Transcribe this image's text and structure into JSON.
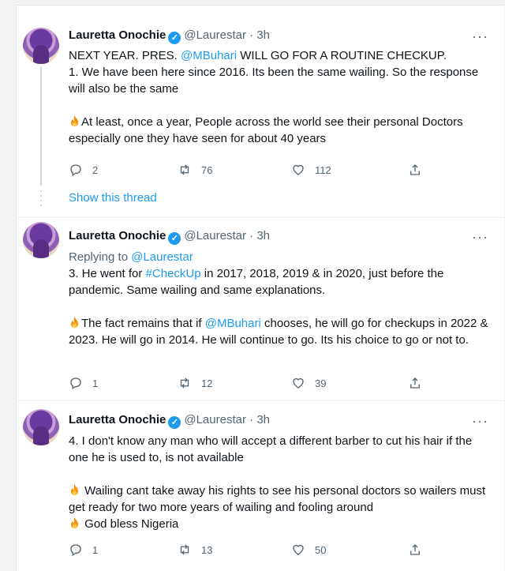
{
  "tweets": [
    {
      "name": "Lauretta Onochie",
      "handle": "@Laurestar",
      "sep": "·",
      "time": "3h",
      "line1_a": "NEXT YEAR. PRES. ",
      "line1_mention": "@MBuhari",
      "line1_b": " WILL GO FOR A ROUTINE CHECKUP.",
      "para1": "1. We have been here since 2016. Its been the same wailing. So the response will also be the same",
      "para2": "At least, once a year, People across the world see their personal Doctors especially one they have seen for about 40 years",
      "replies": "2",
      "retweets": "76",
      "likes": "112"
    },
    {
      "name": "Lauretta Onochie",
      "handle": "@Laurestar",
      "sep": "·",
      "time": "3h",
      "replying_label": "Replying to ",
      "replying_to": "@Laurestar",
      "line1_a": "3. He went for ",
      "line1_hashtag": "#CheckUp",
      "line1_b": " in 2017, 2018, 2019 & in 2020, just before the pandemic. Same wailing and same explanations.",
      "para2_a": "The fact remains that if ",
      "para2_mention": "@MBuhari",
      "para2_b": " chooses, he will go for checkups in 2022 & 2023. He will go in 2014. He will continue to go. Its his choice to go or not to.",
      "replies": "1",
      "retweets": "12",
      "likes": "39"
    },
    {
      "name": "Lauretta Onochie",
      "handle": "@Laurestar",
      "sep": "·",
      "time": "3h",
      "para1": "4. I don't know any man who will accept a different barber to cut his hair if the one he is used to, is not available",
      "para2": " Wailing cant take away his rights to see his personal doctors so wailers must get ready for two more years of wailing and fooling around",
      "para3": " God bless Nigeria",
      "replies": "1",
      "retweets": "13",
      "likes": "50"
    }
  ],
  "show_thread": "Show this thread",
  "more_label": "···",
  "badge_glyph": "✓",
  "icons": {
    "verified": "verified-badge-icon",
    "reply": "reply-icon",
    "retweet": "retweet-icon",
    "like": "heart-icon",
    "share": "share-icon",
    "fire": "fire-emoji-icon"
  },
  "colors": {
    "link": "#1d9bf0",
    "secondary": "#536471",
    "text": "#0f1419"
  }
}
